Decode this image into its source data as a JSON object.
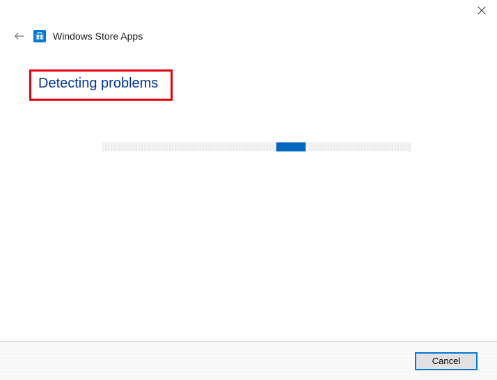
{
  "titlebar": {
    "close_icon": "close"
  },
  "header": {
    "back_icon": "back-arrow",
    "app_icon": "windows-store-icon",
    "app_title": "Windows Store Apps"
  },
  "main": {
    "heading": "Detecting problems"
  },
  "progress": {
    "state": "indeterminate"
  },
  "footer": {
    "cancel_label": "Cancel"
  },
  "colors": {
    "accent": "#0078d7",
    "heading": "#003399",
    "highlight_border": "#e6000b"
  }
}
